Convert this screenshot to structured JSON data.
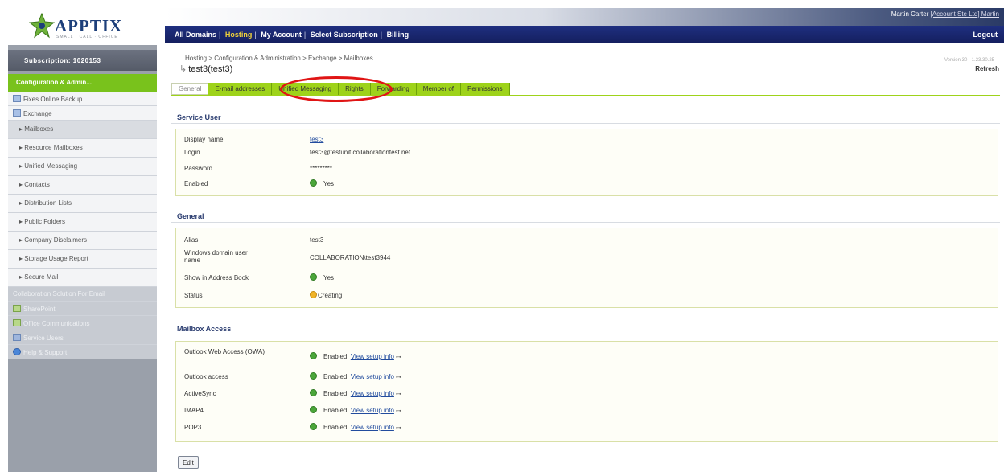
{
  "brand": {
    "name": "APPTIX",
    "tagline": "SMALL · CALL · OFFICE"
  },
  "topbar": {
    "user_text": "Martin Carter",
    "account_link": "[Account Ste Ltd] Martin",
    "nav": [
      {
        "label": "All Domains",
        "active": false
      },
      {
        "label": "Hosting",
        "active": true
      },
      {
        "label": "My Account",
        "active": false
      },
      {
        "label": "Select Subscription",
        "active": false
      },
      {
        "label": "Billing",
        "active": false
      }
    ],
    "logout": "Logout"
  },
  "sidebar": {
    "subscription": "Subscription: 1020153",
    "config": "Configuration & Admin...",
    "items": [
      {
        "label": "Fixes Online Backup",
        "icon": "backup-icon",
        "style": "item"
      },
      {
        "label": "Exchange",
        "icon": "exchange-icon",
        "style": "item"
      },
      {
        "label": "Mailboxes",
        "style": "sub-selected"
      },
      {
        "label": "Resource Mailboxes",
        "style": "sub"
      },
      {
        "label": "Unified Messaging",
        "style": "sub"
      },
      {
        "label": "Contacts",
        "style": "sub"
      },
      {
        "label": "Distribution Lists",
        "style": "sub"
      },
      {
        "label": "Public Folders",
        "style": "sub"
      },
      {
        "label": "Company Disclaimers",
        "style": "sub"
      },
      {
        "label": "Storage Usage Report",
        "style": "sub"
      },
      {
        "label": "Secure Mail",
        "style": "sub"
      },
      {
        "label": "Collaboration Solution For Email",
        "style": "gray"
      },
      {
        "label": "SharePoint",
        "icon": "sharepoint-icon",
        "style": "gray"
      },
      {
        "label": "Office Communications",
        "icon": "communications-icon",
        "style": "gray"
      },
      {
        "label": "Service Users",
        "icon": "users-icon",
        "style": "gray"
      },
      {
        "label": "Help & Support",
        "icon": "help-icon",
        "style": "gray"
      }
    ]
  },
  "header": {
    "breadcrumb": "Hosting > Configuration & Administration > Exchange > Mailboxes",
    "title": "test3(test3)",
    "version": "Version 30 - 1.23.30.25",
    "refresh": "Refresh"
  },
  "tabs": [
    {
      "label": "General",
      "active": true
    },
    {
      "label": "E-mail addresses",
      "active": false
    },
    {
      "label": "Unified Messaging",
      "active": false,
      "circled": true
    },
    {
      "label": "Rights",
      "active": false
    },
    {
      "label": "Forwarding",
      "active": false
    },
    {
      "label": "Member of",
      "active": false
    },
    {
      "label": "Permissions",
      "active": false
    }
  ],
  "service_user": {
    "title": "Service User",
    "display_name_label": "Display name",
    "display_name": "test3",
    "login_label": "Login",
    "login": "test3@testunit.collaborationtest.net",
    "password_label": "Password",
    "password": "*********",
    "enabled_label": "Enabled",
    "enabled": "Yes"
  },
  "general": {
    "title": "General",
    "alias_label": "Alias",
    "alias": "test3",
    "windows_label": "Windows domain user name",
    "windows": "COLLABORATION\\test3944",
    "show_label": "Show in Address Book",
    "show": "Yes",
    "status_label": "Status",
    "status": "Creating"
  },
  "mailbox_access": {
    "title": "Mailbox Access",
    "enabled_text": "Enabled",
    "setup_link": "View setup info",
    "rows": [
      {
        "label": "Outlook Web Access (OWA)"
      },
      {
        "label": "Outlook access"
      },
      {
        "label": "ActiveSync"
      },
      {
        "label": "IMAP4"
      },
      {
        "label": "POP3"
      }
    ]
  },
  "edit_button": "Edit",
  "colors": {
    "nav_bar": "#1b2a74",
    "tab_green": "#9ed31a",
    "sidebar_green": "#79c21c",
    "highlight": "#e01515"
  }
}
